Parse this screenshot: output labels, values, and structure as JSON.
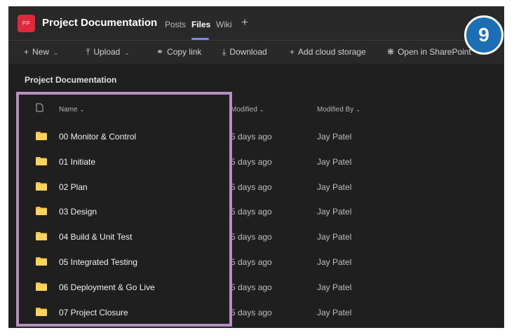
{
  "header": {
    "avatar_initials": "PP",
    "team_title": "Project Documentation",
    "tabs": [
      {
        "label": "Posts"
      },
      {
        "label": "Files"
      },
      {
        "label": "Wiki"
      }
    ],
    "add_tab": "+"
  },
  "toolbar": {
    "new_label": "New",
    "upload_label": "Upload",
    "copy_link_label": "Copy link",
    "download_label": "Download",
    "add_cloud_label": "Add cloud storage",
    "sharepoint_label": "Open in SharePoint"
  },
  "step_badge": "9",
  "breadcrumb": "Project Documentation",
  "columns": {
    "name": "Name",
    "modified": "Modified",
    "modified_by": "Modified By"
  },
  "rows": [
    {
      "name": "00 Monitor & Control",
      "modified": "5 days ago",
      "modified_by": "Jay Patel"
    },
    {
      "name": "01 Initiate",
      "modified": "5 days ago",
      "modified_by": "Jay Patel"
    },
    {
      "name": "02 Plan",
      "modified": "5 days ago",
      "modified_by": "Jay Patel"
    },
    {
      "name": "03 Design",
      "modified": "5 days ago",
      "modified_by": "Jay Patel"
    },
    {
      "name": "04 Build & Unit Test",
      "modified": "5 days ago",
      "modified_by": "Jay Patel"
    },
    {
      "name": "05 Integrated Testing",
      "modified": "5 days ago",
      "modified_by": "Jay Patel"
    },
    {
      "name": "06 Deployment & Go Live",
      "modified": "5 days ago",
      "modified_by": "Jay Patel"
    },
    {
      "name": "07 Project Closure",
      "modified": "5 days ago",
      "modified_by": "Jay Patel"
    }
  ],
  "colors": {
    "accent": "#7f85f5",
    "avatar": "#e0283d",
    "folder": "#f5c542",
    "highlight": "#b98fc2",
    "badge": "#1a6fb5"
  }
}
